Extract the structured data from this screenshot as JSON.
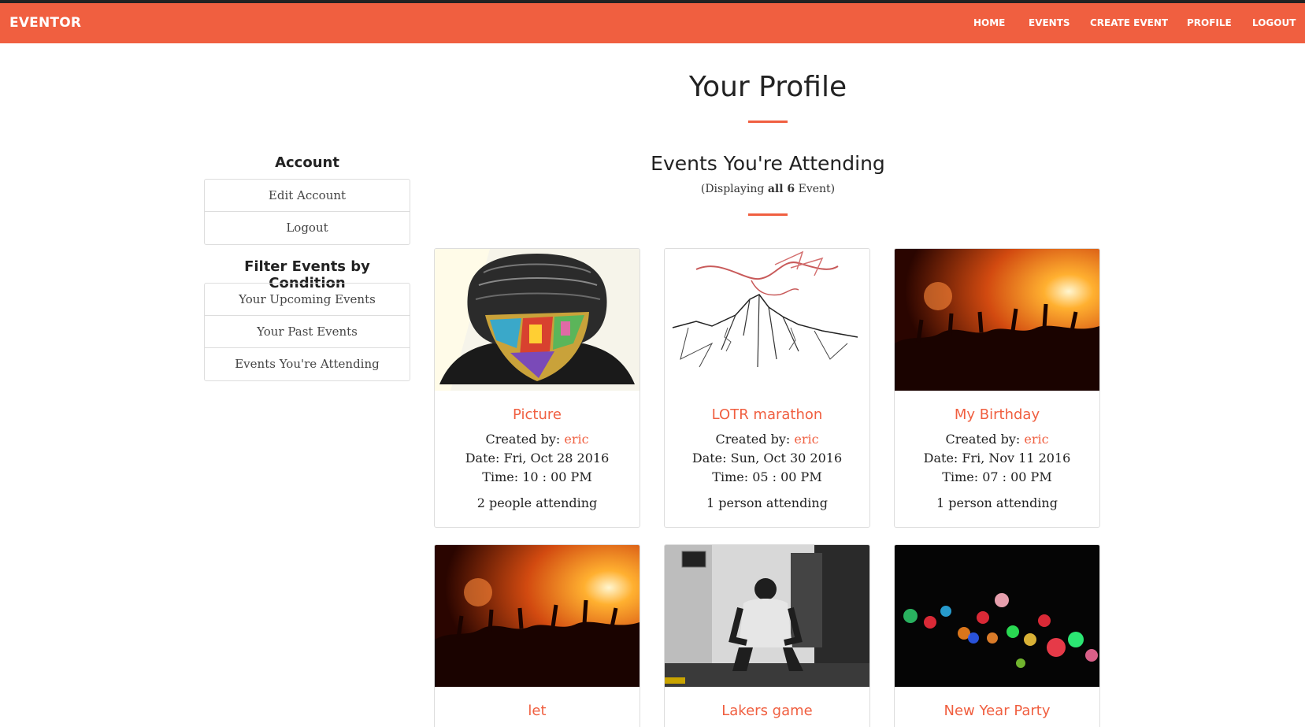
{
  "nav": {
    "brand": "EVENTOR",
    "items": [
      "HOME",
      "EVENTS",
      "CREATE EVENT",
      "PROFILE",
      "LOGOUT"
    ]
  },
  "page_title": "Your Profile",
  "sidebar": {
    "account_heading": "Account",
    "account_items": [
      "Edit Account",
      "Logout"
    ],
    "filter_heading": "Filter Events by Condition",
    "filter_items": [
      "Your Upcoming Events",
      "Your Past Events",
      "Events You're Attending"
    ]
  },
  "section": {
    "title": "Events You're Attending",
    "display_prefix": "(Displaying",
    "display_bold": "all 6",
    "display_suffix": "Event)"
  },
  "events": [
    {
      "title": "Picture",
      "created_label": "Created by:",
      "author": "eric",
      "date": "Date: Fri, Oct 28 2016",
      "time": "Time: 10 : 00 PM",
      "attending": "2 people attending",
      "image": "masked-portrait"
    },
    {
      "title": "LOTR marathon",
      "created_label": "Created by:",
      "author": "eric",
      "date": "Date: Sun, Oct 30 2016",
      "time": "Time: 05 : 00 PM",
      "attending": "1 person attending",
      "image": "dragon-mountain-sketch"
    },
    {
      "title": "My Birthday",
      "created_label": "Created by:",
      "author": "eric",
      "date": "Date: Fri, Nov 11 2016",
      "time": "Time: 07 : 00 PM",
      "attending": "1 person attending",
      "image": "concert-crowd"
    },
    {
      "title": "let",
      "image": "concert-crowd"
    },
    {
      "title": "Lakers game",
      "image": "basketball-locker-room"
    },
    {
      "title": "New Year Party",
      "image": "bokeh-lights"
    }
  ],
  "colors": {
    "accent": "#f05f40",
    "text": "#222222",
    "border": "#dddddd"
  }
}
